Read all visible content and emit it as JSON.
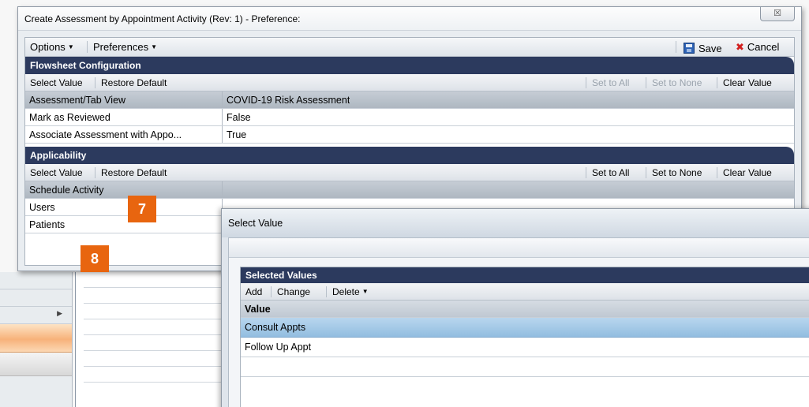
{
  "main_dialog": {
    "title": "Create Assessment by Appointment Activity (Rev: 1) - Preference:",
    "close_label": "☒",
    "toolbar": {
      "options": "Options",
      "preferences": "Preferences",
      "save": "Save",
      "cancel": "Cancel"
    },
    "flowsheet": {
      "header": "Flowsheet Configuration",
      "actions": {
        "select_value": "Select Value",
        "restore_default": "Restore Default",
        "set_to_all": "Set to All",
        "set_to_none": "Set to None",
        "clear_value": "Clear Value"
      },
      "rows": [
        {
          "label": "Assessment/Tab View",
          "value": "COVID-19 Risk Assessment"
        },
        {
          "label": "Mark as Reviewed",
          "value": "False"
        },
        {
          "label": "Associate Assessment with Appo...",
          "value": "True"
        }
      ]
    },
    "applicability": {
      "header": "Applicability",
      "actions": {
        "select_value": "Select Value",
        "restore_default": "Restore Default",
        "set_to_all": "Set to All",
        "set_to_none": "Set to None",
        "clear_value": "Clear Value"
      },
      "rows": [
        {
          "label": "Schedule Activity"
        },
        {
          "label": "Users"
        },
        {
          "label": "Patients"
        }
      ]
    }
  },
  "callouts": [
    "7",
    "8"
  ],
  "select_dialog": {
    "title": "Select Value",
    "panel_header": "Selected Values",
    "actions": {
      "add": "Add",
      "change": "Change",
      "delete": "Delete"
    },
    "column_header": "Value",
    "rows": [
      "Consult Appts",
      "Follow Up Appt"
    ]
  },
  "colors": {
    "section_header": "#2c3a5e",
    "callout": "#e8650f",
    "selected_row": "#a6c9e8",
    "cancel_icon": "#d21f1f",
    "save_icon": "#2d62b5"
  }
}
